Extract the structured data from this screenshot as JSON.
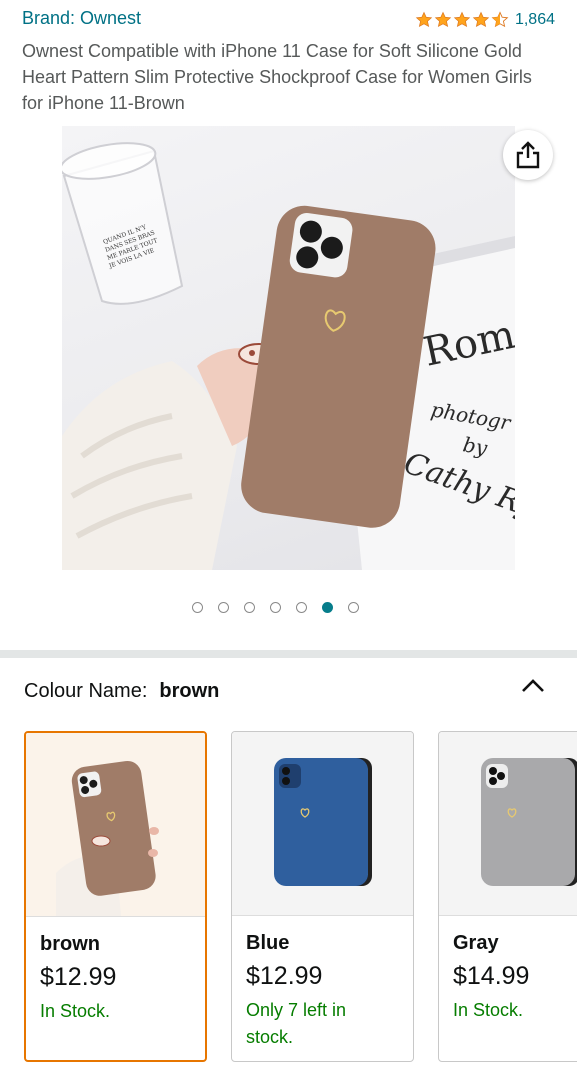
{
  "header": {
    "brand": "Brand: Ownest",
    "rating_count": "1,864",
    "stars": 4.5,
    "title": "Ownest Compatible with iPhone 11 Case for Soft Silicone Gold Heart Pattern Slim Protective Shockproof Case for Women Girls for iPhone 11-Brown"
  },
  "gallery": {
    "book_lines": [
      "Rom",
      "photogr",
      "by",
      "Cathy Rya"
    ],
    "glass_text": [
      "QUAND IL N'Y",
      "DANS SES BRAS",
      "ME PARLE TOUT",
      "JE VOIS LA VIE"
    ],
    "image_count": 7,
    "active_index": 5,
    "icon": "share-icon"
  },
  "colour": {
    "label": "Colour Name:",
    "selected": "brown",
    "toggle_icon": "chevron-up-icon"
  },
  "swatches": [
    {
      "name": "brown",
      "price": "$12.99",
      "stock": "In Stock."
    },
    {
      "name": "Blue",
      "price": "$12.99",
      "stock": "Only 7 left in stock."
    },
    {
      "name": "Gray",
      "price": "$14.99",
      "stock": "In Stock."
    }
  ],
  "colors": {
    "link": "#007185",
    "star": "#ffa41c",
    "selected_border": "#e77600",
    "in_stock": "#067d00",
    "case_brown": "#a07c68",
    "case_blue": "#2f5f9e",
    "case_gray": "#a9a9ab"
  }
}
